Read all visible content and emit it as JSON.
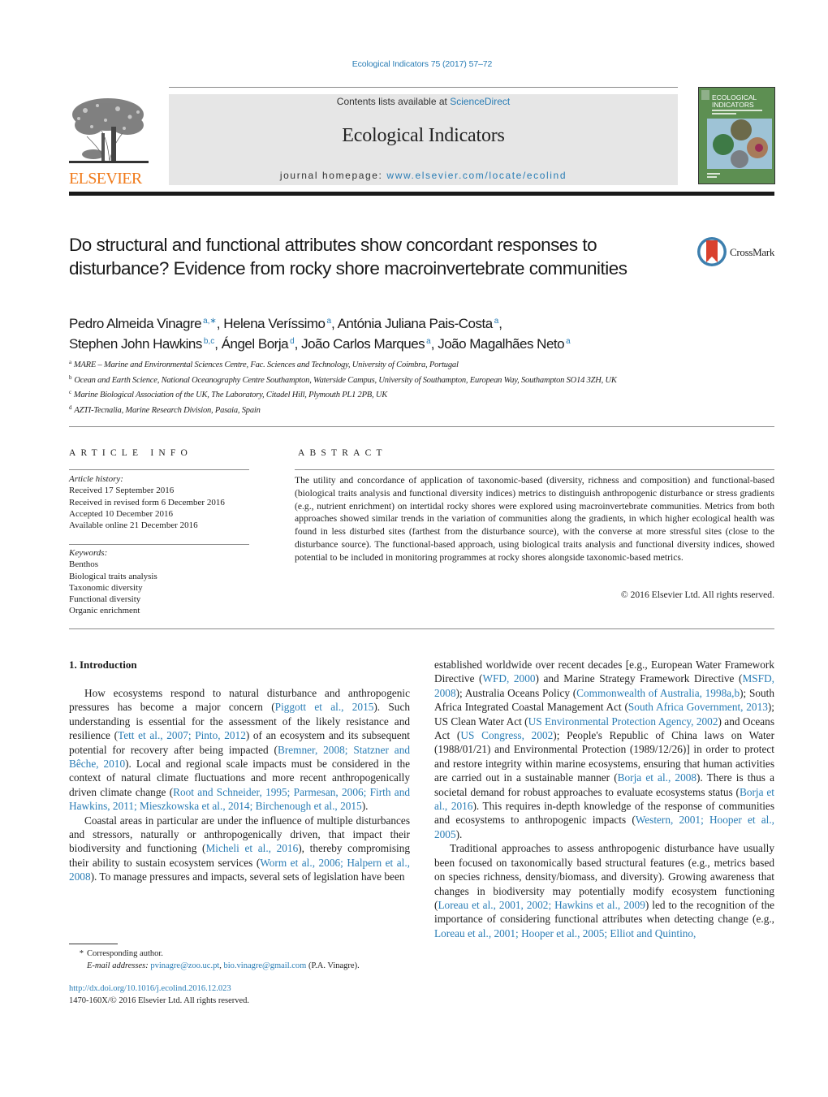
{
  "header": {
    "journal_reference": "Ecological Indicators 75 (2017) 57–72",
    "contents_prefix": "Contents lists available at ",
    "contents_link": "ScienceDirect",
    "journal_title": "Ecological Indicators",
    "homepage_prefix": "journal homepage: ",
    "homepage_link": "www.elsevier.com/locate/ecolind",
    "publisher_logo_text": "ELSEVIER",
    "cover_title_line1": "ECOLOGICAL",
    "cover_title_line2": "INDICATORS"
  },
  "article": {
    "title": "Do structural and functional attributes show concordant responses to disturbance? Evidence from rocky shore macroinvertebrate communities",
    "crossmark_label": "CrossMark",
    "authors_line1": [
      {
        "name": "Pedro Almeida Vinagre",
        "sup": "a,∗",
        "sep": ", "
      },
      {
        "name": "Helena Veríssimo",
        "sup": "a",
        "sep": ", "
      },
      {
        "name": "Antónia Juliana Pais-Costa",
        "sup": "a",
        "sep": ","
      }
    ],
    "authors_line2": [
      {
        "name": "Stephen John Hawkins",
        "sup": "b,c",
        "sep": ", "
      },
      {
        "name": "Ángel Borja",
        "sup": "d",
        "sep": ", "
      },
      {
        "name": "João Carlos Marques",
        "sup": "a",
        "sep": ", "
      },
      {
        "name": "João Magalhães Neto",
        "sup": "a",
        "sep": ""
      }
    ],
    "affiliations": [
      {
        "key": "a",
        "text": "MARE – Marine and Environmental Sciences Centre, Fac. Sciences and Technology, University of Coimbra, Portugal"
      },
      {
        "key": "b",
        "text": "Ocean and Earth Science, National Oceanography Centre Southampton, Waterside Campus, University of Southampton, European Way, Southampton SO14 3ZH, UK"
      },
      {
        "key": "c",
        "text": "Marine Biological Association of the UK, The Laboratory, Citadel Hill, Plymouth PL1 2PB, UK"
      },
      {
        "key": "d",
        "text": "AZTI-Tecnalia, Marine Research Division, Pasaia, Spain"
      }
    ]
  },
  "article_info": {
    "label": "ARTICLE INFO",
    "history_header": "Article history:",
    "history": [
      "Received 17 September 2016",
      "Received in revised form 6 December 2016",
      "Accepted 10 December 2016",
      "Available online 21 December 2016"
    ],
    "keywords_header": "Keywords:",
    "keywords": [
      "Benthos",
      "Biological traits analysis",
      "Taxonomic diversity",
      "Functional diversity",
      "Organic enrichment"
    ]
  },
  "abstract": {
    "label": "ABSTRACT",
    "text": "The utility and concordance of application of taxonomic-based (diversity, richness and composition) and functional-based (biological traits analysis and functional diversity indices) metrics to distinguish anthropogenic disturbance or stress gradients (e.g., nutrient enrichment) on intertidal rocky shores were explored using macroinvertebrate communities. Metrics from both approaches showed similar trends in the variation of communities along the gradients, in which higher ecological health was found in less disturbed sites (farthest from the disturbance source), with the converse at more stressful sites (close to the disturbance source). The functional-based approach, using biological traits analysis and functional diversity indices, showed potential to be included in monitoring programmes at rocky shores alongside taxonomic-based metrics.",
    "copyright": "© 2016 Elsevier Ltd. All rights reserved."
  },
  "body": {
    "section_heading": "1.  Introduction",
    "left_paragraphs": [
      [
        {
          "t": "How ecosystems respond to natural disturbance and anthro­pogenic pressures has become a major concern ("
        },
        {
          "l": "Piggott et al., 2015"
        },
        {
          "t": "). Such understanding is essential for the assessment of the likely resistance and resilience ("
        },
        {
          "l": "Tett et al., 2007; Pinto, 2012"
        },
        {
          "t": ") of an ecosys­tem and its subsequent potential for recovery after being impacted ("
        },
        {
          "l": "Bremner, 2008; Statzner and Bêche, 2010"
        },
        {
          "t": "). Local and regional scale impacts must be considered in the context of natural climate fluc­tuations and more recent anthropogenically driven climate change ("
        },
        {
          "l": "Root and Schneider, 1995; Parmesan, 2006; Firth and Hawkins, 2011; Mieszkowska et al., 2014; Birchenough et al., 2015"
        },
        {
          "t": ")."
        }
      ],
      [
        {
          "t": "Coastal areas in particular are under the influence of mul­tiple disturbances and stressors, naturally or anthropogenically driven, that impact their biodiversity and functioning ("
        },
        {
          "l": "Micheli et al., 2016"
        },
        {
          "t": "), thereby compromising their ability to sustain ecosystem services ("
        },
        {
          "l": "Worm et al., 2006; Halpern et al., 2008"
        },
        {
          "t": "). To man­age pressures and impacts, several sets of legislation have been"
        }
      ]
    ],
    "right_paragraphs": [
      [
        {
          "t": "established worldwide over recent decades [e.g., European Water Framework Directive ("
        },
        {
          "l": "WFD, 2000"
        },
        {
          "t": ") and Marine Strategy Framework Directive ("
        },
        {
          "l": "MSFD, 2008"
        },
        {
          "t": "); Australia Oceans Policy ("
        },
        {
          "l": "Commonwealth of Australia, 1998a,b"
        },
        {
          "t": "); South Africa Integrated Coastal Manage­ment Act ("
        },
        {
          "l": "South Africa Government, 2013"
        },
        {
          "t": "); US Clean Water Act ("
        },
        {
          "l": "US Environmental Protection Agency, 2002"
        },
        {
          "t": ") and Oceans Act ("
        },
        {
          "l": "US Congress, 2002"
        },
        {
          "t": "); People's Republic of China laws on Water (1988/01/21) and Environmental Protection (1989/12/26)] in order to protect and restore integrity within marine ecosystems, ensuring that human activities are carried out in a sustainable manner ("
        },
        {
          "l": "Borja et al., 2008"
        },
        {
          "t": "). There is thus a societal demand for robust approaches to evaluate ecosystems status ("
        },
        {
          "l": "Borja et al., 2016"
        },
        {
          "t": "). This requires in-depth knowledge of the response of communities and ecosystems to anthropogenic impacts ("
        },
        {
          "l": "Western, 2001; Hooper et al., 2005"
        },
        {
          "t": ")."
        }
      ],
      [
        {
          "t": "Traditional approaches to assess anthropogenic disturbance have usually been focused on taxonomically based structural fea­tures (e.g., metrics based on species richness, density/biomass, and diversity). Growing awareness that changes in biodiversity may potentially modify ecosystem functioning ("
        },
        {
          "l": "Loreau et al., 2001, 2002; Hawkins et al., 2009"
        },
        {
          "t": ") led to the recognition of the impor­tance of considering functional attributes when detecting change (e.g., "
        },
        {
          "l": "Loreau et al., 2001; Hooper et al., 2005; Elliot and Quintino,"
        }
      ]
    ]
  },
  "footnotes": {
    "star": "*",
    "corresponding": "Corresponding author.",
    "email_label": "E-mail addresses: ",
    "email_1": "pvinagre@zoo.uc.pt",
    "email_sep": ", ",
    "email_2": "bio.vinagre@gmail.com",
    "email_suffix": " (P.A. Vinagre).",
    "doi": "http://dx.doi.org/10.1016/j.ecolind.2016.12.023",
    "issn_line": "1470-160X/© 2016 Elsevier Ltd. All rights reserved."
  },
  "colors": {
    "link": "#2a7db5",
    "elsevier_orange": "#f07a1a",
    "masthead_gray": "#e6e6e6",
    "crossmark_red": "#d9412e"
  }
}
